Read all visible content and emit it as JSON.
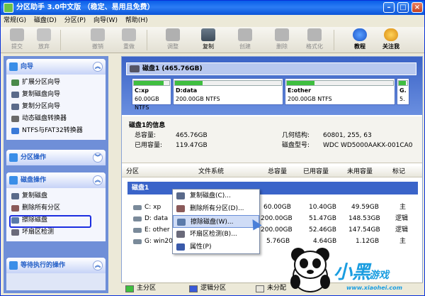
{
  "window": {
    "title": "分区助手 3.0中文版 （稳定、易用且免费）",
    "minimize": "–",
    "maximize": "□",
    "close": "×"
  },
  "menu": [
    "常规(G)",
    "磁盘(D)",
    "分区(P)",
    "向导(W)",
    "帮助(H)"
  ],
  "toolbar": [
    {
      "label": "提交",
      "icon": "commit-icon",
      "state": "disabled"
    },
    {
      "label": "放弃",
      "icon": "discard-icon",
      "state": "disabled"
    },
    {
      "label": "撤销",
      "icon": "undo-icon",
      "state": "disabled"
    },
    {
      "label": "重做",
      "icon": "redo-icon",
      "state": "disabled"
    },
    {
      "label": "调整",
      "icon": "resize-icon",
      "state": "disabled"
    },
    {
      "label": "复制",
      "icon": "copy-icon",
      "state": "enabled"
    },
    {
      "label": "创建",
      "icon": "create-icon",
      "state": "disabled"
    },
    {
      "label": "删除",
      "icon": "delete-icon",
      "state": "disabled"
    },
    {
      "label": "格式化",
      "icon": "format-icon",
      "state": "disabled"
    },
    {
      "label": "教程",
      "icon": "help-icon",
      "state": "enabled"
    },
    {
      "label": "关注我",
      "icon": "follow-icon",
      "state": "enabled"
    }
  ],
  "sidebar": {
    "wizard": {
      "title": "向导",
      "items": [
        "扩展分区向导",
        "复制磁盘向导",
        "复制分区向导",
        "动态磁盘转换器",
        "NTFS与FAT32转换器"
      ]
    },
    "partition_ops": {
      "title": "分区操作"
    },
    "disk_ops": {
      "title": "磁盘操作",
      "items": [
        "复制磁盘",
        "删除所有分区",
        "擦除磁盘",
        "坏扇区检测"
      ]
    },
    "pending": {
      "title": "等待执行的操作"
    }
  },
  "disk_map": {
    "label": "磁盘1 (465.76GB)",
    "partitions": [
      {
        "name": "C:xp",
        "size": "60.00GB NTFS",
        "fill": 0.83
      },
      {
        "name": "D:data",
        "size": "200.00GB NTFS",
        "fill": 0.26
      },
      {
        "name": "E:other",
        "size": "200.00GB NTFS",
        "fill": 0.26
      },
      {
        "name": "G.",
        "size": "5.",
        "fill": 0.8
      }
    ]
  },
  "disk_info": {
    "title": "磁盘1的信息",
    "total_label": "总容量:",
    "total_value": "465.76GB",
    "used_label": "已用容量:",
    "used_value": "119.47GB",
    "geometry_label": "几何结构:",
    "geometry_value": "60801, 255, 63",
    "model_label": "磁盘型号:",
    "model_value": "WDC WD5000AAKX-001CA0"
  },
  "table": {
    "headers": [
      "分区",
      "文件系统",
      "总容量",
      "已用容量",
      "未用容量",
      "标记"
    ],
    "group": "磁盘1",
    "rows": [
      {
        "name": "C: xp",
        "total": "60.00GB",
        "used": "10.40GB",
        "free": "49.59GB",
        "flag": "主"
      },
      {
        "name": "D: data",
        "total": "200.00GB",
        "used": "51.47GB",
        "free": "148.53GB",
        "flag": "逻辑"
      },
      {
        "name": "E: other",
        "total": "200.00GB",
        "used": "52.46GB",
        "free": "147.54GB",
        "flag": "逻辑"
      },
      {
        "name": "G: win200",
        "total": "5.76GB",
        "used": "4.64GB",
        "free": "1.12GB",
        "flag": "主"
      }
    ]
  },
  "context_menu": [
    {
      "label": "复制磁盘(C)...",
      "icon": "copy-disk-icon"
    },
    {
      "label": "删除所有分区(D)...",
      "icon": "delete-all-icon"
    },
    {
      "label": "擦除磁盘(W)...",
      "icon": "wipe-disk-icon",
      "selected": true
    },
    {
      "label": "坏扇区检测(B)...",
      "icon": "bad-sector-icon"
    },
    {
      "label": "属性(P)",
      "icon": "properties-icon"
    }
  ],
  "legend": [
    "主分区",
    "逻辑分区",
    "未分配"
  ],
  "watermark": {
    "brand": "小黑",
    "brand2": "游戏",
    "site": "www.xiaohei.com"
  }
}
